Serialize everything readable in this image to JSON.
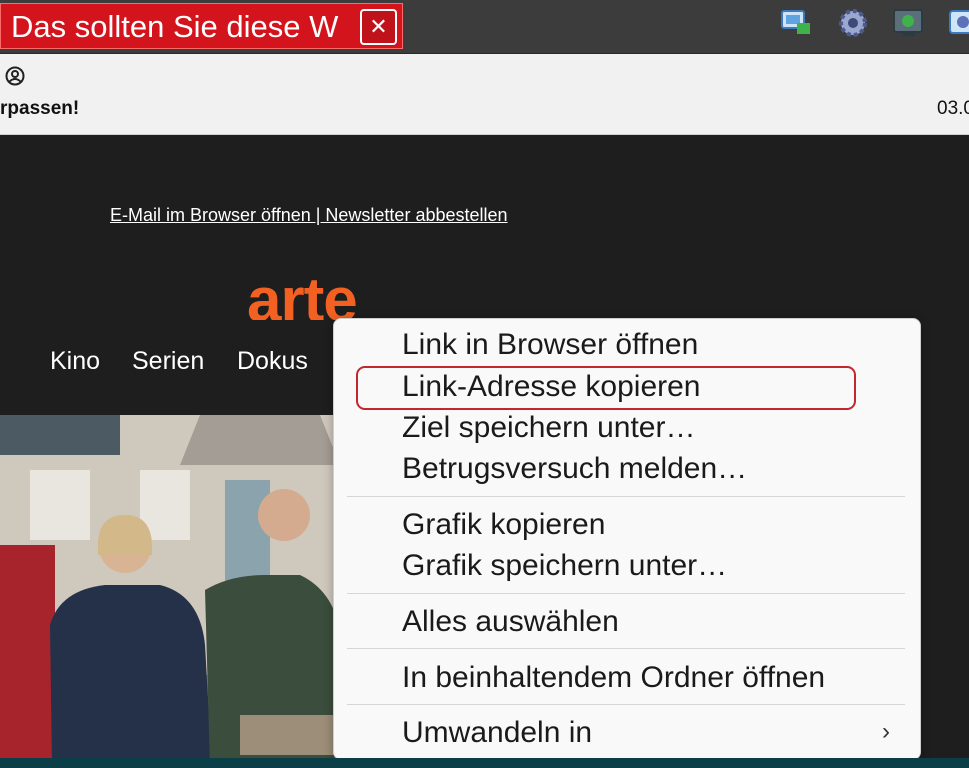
{
  "alert": {
    "text": "Das sollten Sie diese W",
    "close": "✕"
  },
  "tray": {
    "icons": [
      "network-icon",
      "gear-icon",
      "monitor-icon",
      "gear-icon"
    ]
  },
  "infobar": {
    "left": "rpassen!",
    "right": "03.0"
  },
  "mail": {
    "links": "E-Mail im Browser öffnen | Newsletter abbestellen",
    "logo": "arte",
    "nav": [
      "Kino",
      "Serien",
      "Dokus"
    ]
  },
  "menu": {
    "items": [
      "Link in Browser öffnen",
      "Link-Adresse kopieren",
      "Ziel speichern unter…",
      "Betrugsversuch melden…",
      "Grafik kopieren",
      "Grafik speichern unter…",
      "Alles auswählen",
      "In beinhaltendem Ordner öffnen",
      "Umwandeln in"
    ],
    "chevron": "›"
  },
  "colors": {
    "alert": "#d4141c",
    "arte": "#f26122",
    "highlight": "#c1272d"
  }
}
